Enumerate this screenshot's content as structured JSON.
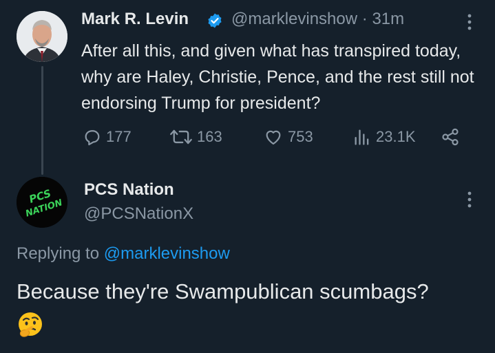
{
  "tweet": {
    "author_name": "Mark R. Levin",
    "handle": "@marklevinshow",
    "separator": "·",
    "time": "31m",
    "text": "After all this, and given what has transpired today, why are Haley, Christie, Pence, and the rest still not endorsing Trump for president?",
    "replies": "177",
    "retweets": "163",
    "likes": "753",
    "views": "23.1K"
  },
  "reply": {
    "author_name": "PCS Nation",
    "handle": "@PCSNationX",
    "avatar_text": "PCS NATION",
    "replying_prefix": "Replying to",
    "replying_to": "@marklevinshow",
    "text": "Because they're Swampublican scumbags?",
    "emoji": "thinking-face"
  },
  "colors": {
    "background": "#15202b",
    "accent": "#1d9bf0",
    "muted": "#8b98a5",
    "verified": "#1d9bf0",
    "pcs_green": "#39d353"
  }
}
